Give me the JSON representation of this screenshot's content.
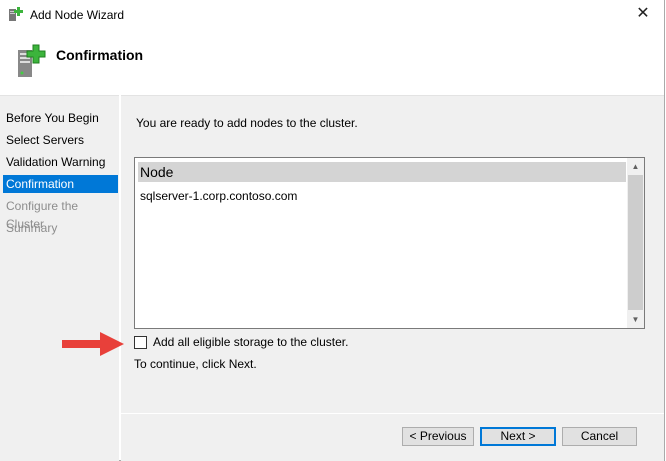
{
  "window": {
    "title": "Add Node Wizard",
    "close_icon": "close-icon"
  },
  "header": {
    "title": "Confirmation"
  },
  "sidebar": {
    "items": [
      {
        "label": "Before You Begin",
        "state": "done"
      },
      {
        "label": "Select Servers",
        "state": "done"
      },
      {
        "label": "Validation Warning",
        "state": "done"
      },
      {
        "label": "Confirmation",
        "state": "selected"
      },
      {
        "label": "Configure the Cluster",
        "state": "disabled"
      },
      {
        "label": "Summary",
        "state": "disabled"
      }
    ]
  },
  "main": {
    "intro": "You are ready to add nodes to the cluster.",
    "list": {
      "header": "Node",
      "rows": [
        "sqlserver-1.corp.contoso.com"
      ]
    },
    "checkbox": {
      "label": "Add all eligible storage to the cluster.",
      "checked": false
    },
    "continue_text": "To continue, click Next."
  },
  "buttons": {
    "previous": "< Previous",
    "next": "Next >",
    "cancel": "Cancel"
  },
  "colors": {
    "accent": "#0078d7",
    "arrow": "#e8403a"
  }
}
